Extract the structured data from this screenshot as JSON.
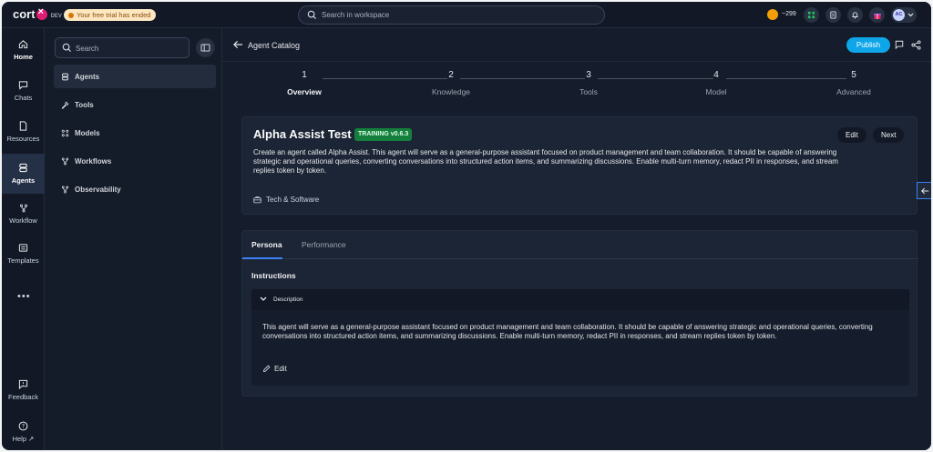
{
  "app": {
    "logo_text": "cort",
    "logo_tail": "",
    "env_tag": "DEV",
    "trial_banner": "Your free trial has ended",
    "search_placeholder": "Search in workspace",
    "credits": "~299",
    "avatar_initials": "AC"
  },
  "rail": {
    "items": [
      {
        "label": "Home",
        "icon": "home-icon"
      },
      {
        "label": "Chats",
        "icon": "chat-icon"
      },
      {
        "label": "Resources",
        "icon": "file-icon"
      },
      {
        "label": "Agents",
        "icon": "database-icon"
      },
      {
        "label": "Workflow",
        "icon": "workflow-icon"
      },
      {
        "label": "Templates",
        "icon": "template-icon"
      }
    ],
    "more": "•••",
    "feedback": "Feedback",
    "help": "Help"
  },
  "panel": {
    "search_placeholder": "Search",
    "items": [
      {
        "label": "Agents",
        "icon": "database-icon"
      },
      {
        "label": "Tools",
        "icon": "wrench-icon"
      },
      {
        "label": "Models",
        "icon": "model-icon"
      },
      {
        "label": "Workflows",
        "icon": "workflow-icon"
      },
      {
        "label": "Observability",
        "icon": "observability-icon"
      }
    ]
  },
  "header": {
    "back_label": "Agent Catalog",
    "publish_label": "Publish"
  },
  "stepper": {
    "steps": [
      {
        "num": "1",
        "label": "Overview"
      },
      {
        "num": "2",
        "label": "Knowledge"
      },
      {
        "num": "3",
        "label": "Tools"
      },
      {
        "num": "4",
        "label": "Model"
      },
      {
        "num": "5",
        "label": "Advanced"
      }
    ],
    "active_index": 0
  },
  "agent": {
    "title": "Alpha Assist Test",
    "badge": "TRAINING v0.6.3",
    "description": "Create an agent called Alpha Assist. This agent will serve as a general-purpose assistant focused on product management and team collaboration. It should be capable of answering strategic and operational queries, converting conversations into structured action items, and summarizing discussions. Enable multi-turn memory, redact PII in responses, and stream replies token by token.",
    "edit_label": "Edit",
    "next_label": "Next",
    "category": "Tech & Software"
  },
  "persona": {
    "tabs": [
      "Persona",
      "Performance"
    ],
    "instructions_label": "Instructions",
    "description_label": "Description",
    "description_text": "This agent will serve as a general-purpose assistant focused on product management and team collaboration. It should be capable of answering strategic and operational queries, converting conversations into structured action items, and summarizing discussions. Enable multi-turn memory, redact PII in responses, and stream replies token by token.",
    "edit_label": "Edit"
  },
  "colors": {
    "accent": "#0ea5e9",
    "badge_green": "#15803d",
    "brand_pink": "#e11d74"
  }
}
